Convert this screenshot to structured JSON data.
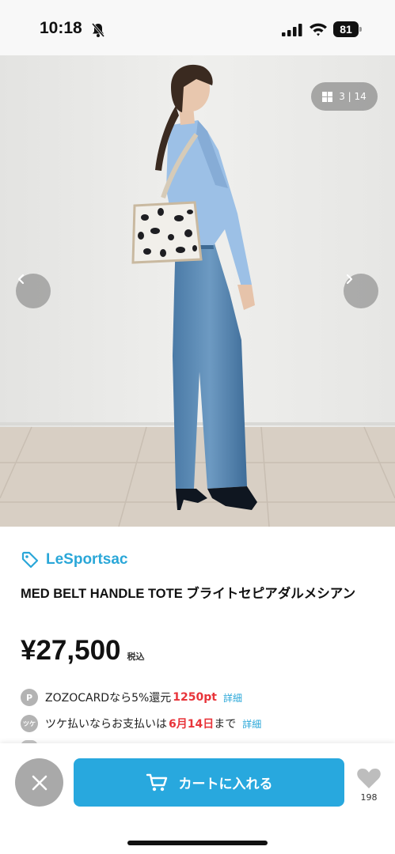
{
  "status_bar": {
    "time": "10:18",
    "battery": "81",
    "icons": [
      "bell-slash-icon",
      "signal-icon",
      "wifi-icon",
      "battery-icon"
    ]
  },
  "gallery": {
    "counter": "3 | 14",
    "current_index": 3,
    "total": 14,
    "icons": [
      "grid-icon",
      "chevron-left-icon",
      "chevron-right-icon"
    ]
  },
  "product": {
    "brand": "LeSportsac",
    "title": "MED BELT HANDLE TOTE ブライトセピアダルメシアン",
    "price": "¥27,500",
    "tax_label": "税込"
  },
  "promos": [
    {
      "icon_text": "P",
      "prefix": "ZOZOCARDなら5%還元 ",
      "highlight": "1250pt",
      "suffix": "",
      "link": "詳細"
    },
    {
      "icon_text": "ツケ",
      "prefix": "ツケ払いならお支払いは",
      "highlight": "6月14日",
      "suffix": "まで",
      "link": "詳細"
    }
  ],
  "actions": {
    "cart_label": "カートに入れる",
    "like_count": "198"
  },
  "colors": {
    "accent": "#28a8de",
    "brand_text": "#2aa7d8",
    "highlight": "#e8343a",
    "close_button": "#a9a9a9"
  }
}
